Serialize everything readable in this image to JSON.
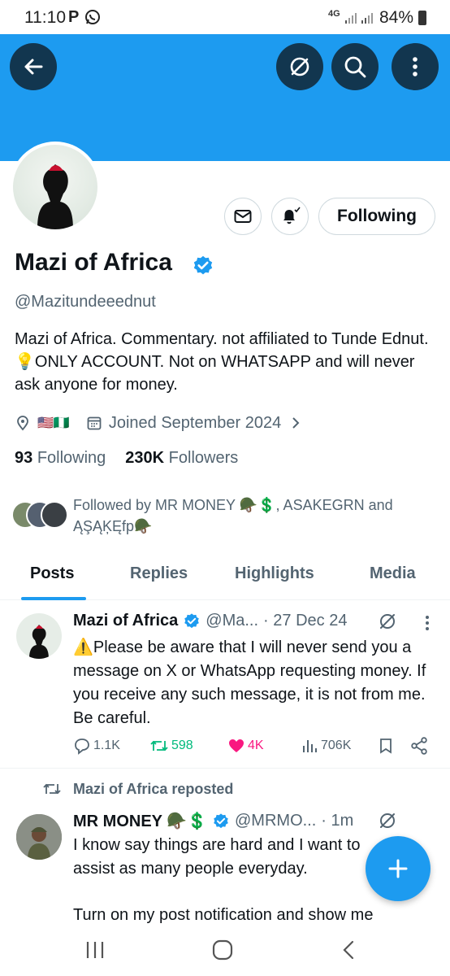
{
  "status_bar": {
    "time": "11:10",
    "p_icon": "P",
    "network": "4G",
    "battery": "84%"
  },
  "header": {
    "back_icon": "arrow-left-icon",
    "grok_icon": "grok-icon",
    "search_icon": "search-icon",
    "more_icon": "more-vertical-icon",
    "banner_color": "#1d9bf0"
  },
  "profile": {
    "name": "Mazi of Africa",
    "handle": "@Mazitundeeednut",
    "bio": "Mazi of Africa. Commentary. not affiliated to Tunde Ednut. 💡ONLY ACCOUNT. Not on WHATSAPP and will never ask anyone for money.",
    "location": "🇺🇸🇳🇬",
    "joined": "Joined September 2024",
    "following_count": "93",
    "following_label": "Following",
    "followers_count": "230K",
    "followers_label": "Followers",
    "followed_by": "Followed by MR MONEY 🪖💲, ASAKEGRN and ĄŞĄĶĘfp🪖",
    "follow_button": "Following"
  },
  "tabs": [
    "Posts",
    "Replies",
    "Highlights",
    "Media"
  ],
  "posts": [
    {
      "name": "Mazi of Africa",
      "handle": "@Ma...",
      "time": "· 27 Dec 24",
      "text": "⚠️Please be aware that I will never send you a message on X or WhatsApp requesting money. If you receive any such message, it is not from me. Be careful.",
      "replies": "1.1K",
      "reposts": "598",
      "likes": "4K",
      "views": "706K"
    },
    {
      "repost_label": "Mazi of Africa reposted",
      "name": "MR MONEY 🪖💲",
      "handle": "@MRMO...",
      "time": "· 1m",
      "text": "I know say things are hard and I want to assist as many people everyday.",
      "text2": "Turn on my post notification and show me"
    }
  ],
  "colors": {
    "accent": "#1d9bf0",
    "repost_green": "#00ba7c",
    "like_pink": "#f91880"
  }
}
